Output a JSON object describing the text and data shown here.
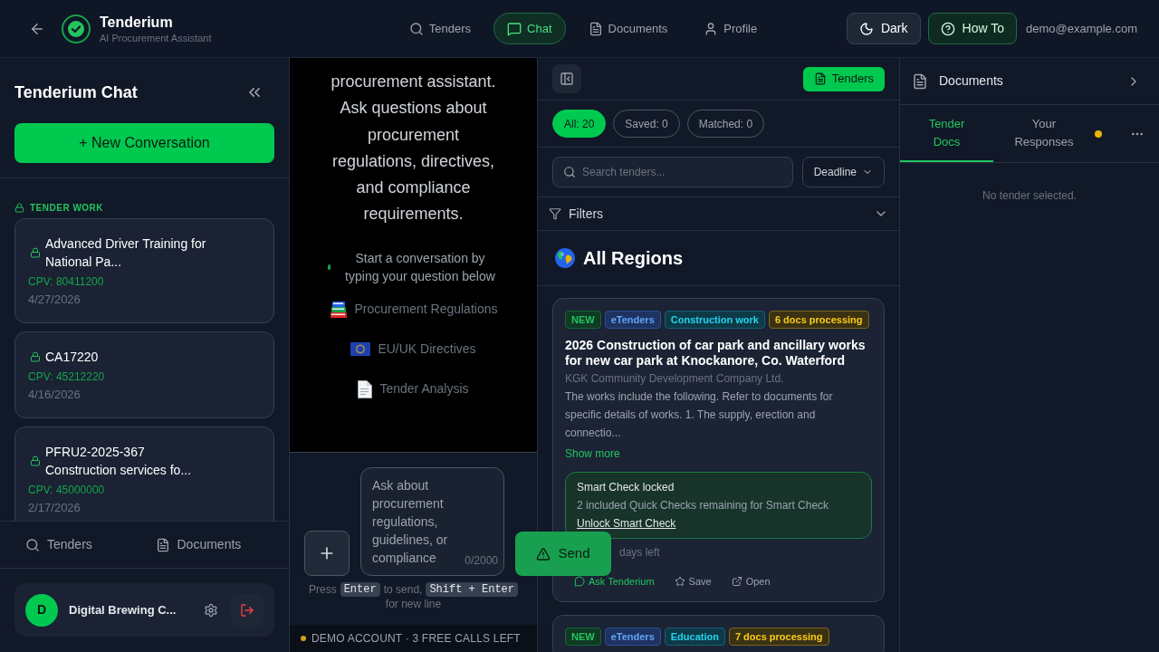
{
  "header": {
    "title": "Tenderium",
    "subtitle": "AI Procurement Assistant",
    "nav": [
      {
        "kind": "search",
        "label": "Tenders",
        "selected": false
      },
      {
        "kind": "chat",
        "label": "Chat",
        "selected": true
      },
      {
        "kind": "document",
        "label": "Documents",
        "selected": false
      },
      {
        "kind": "user",
        "label": "Profile",
        "selected": false
      }
    ],
    "theme_button": "Dark",
    "help_button": "How To",
    "user_email": "demo@example.com"
  },
  "sidebar": {
    "title": "Tenderium Chat",
    "new_button": "+ New Conversation",
    "section_label": "TENDER WORK",
    "conversations": [
      {
        "title": "Advanced Driver Training for National Pa...",
        "cpv": "CPV: 80411200",
        "date": "4/27/2026"
      },
      {
        "title": "CA17220",
        "cpv": "CPV: 45212220",
        "date": "4/16/2026"
      },
      {
        "title": "PFRU2-2025-367 Construction services fo...",
        "cpv": "CPV: 45000000",
        "date": "2/17/2026"
      }
    ],
    "bottom_nav": [
      {
        "kind": "search",
        "label": "Tenders"
      },
      {
        "kind": "document",
        "label": "Documents"
      }
    ],
    "user": {
      "initial": "D",
      "name": "Digital Brewing C..."
    }
  },
  "chat": {
    "intro": "procurement assistant. Ask questions about procurement regulations, directives, and compliance requirements.",
    "prompt": "Start a conversation by typing your question below",
    "topics": [
      {
        "kind": "books",
        "label": "Procurement Regulations"
      },
      {
        "kind": "flag",
        "label": "EU/UK Directives"
      },
      {
        "kind": "document",
        "label": "Tender Analysis"
      }
    ],
    "input": {
      "placeholder": "Ask about procurement regulations, guidelines, or compliance",
      "counter": "0/2000"
    },
    "send_button": "Send",
    "hint": [
      {
        "kind": "text",
        "text": "Press"
      },
      {
        "kind": "key",
        "text": "Enter"
      },
      {
        "kind": "text",
        "text": "to send,"
      },
      {
        "kind": "key",
        "text": "Shift + Enter"
      },
      {
        "kind": "text",
        "text": "for new line"
      }
    ],
    "status": "DEMO ACCOUNT · 3 FREE CALLS LEFT"
  },
  "tenders": {
    "panel_button": "Tenders",
    "filters": [
      {
        "label": "All: 20",
        "selected": true
      },
      {
        "label": "Saved: 0",
        "selected": false
      },
      {
        "label": "Matched: 0",
        "selected": false
      }
    ],
    "search": {
      "placeholder": "Search tenders..."
    },
    "sort": "Deadline",
    "filters_label": "Filters",
    "region": "All Regions",
    "cards": [
      {
        "badges": [
          {
            "kind": "new",
            "label": "NEW"
          },
          {
            "kind": "source",
            "label": "eTenders"
          },
          {
            "kind": "category",
            "label": "Construction work"
          },
          {
            "kind": "processing",
            "label": "6 docs processing"
          }
        ],
        "title": "2026 Construction of car park and ancillary works for new car park at Knockanore, Co. Waterford",
        "org": "KGK Community Development Company Ltd.",
        "description": "The works include the following. Refer to documents for specific details of works. 1. The supply, erection and connectio...",
        "show_more": "Show more",
        "smart_check": {
          "title": "Smart Check locked",
          "text": "2 included Quick Checks remaining for Smart Check",
          "link": "Unlock Smart Check"
        },
        "deadline": "days left",
        "actions": [
          {
            "kind": "ask",
            "label": "Ask Tenderium"
          },
          {
            "kind": "save",
            "label": "Save"
          },
          {
            "kind": "open",
            "label": "Open"
          }
        ]
      },
      {
        "badges": [
          {
            "kind": "new",
            "label": "NEW"
          },
          {
            "kind": "source",
            "label": "eTenders"
          },
          {
            "kind": "category",
            "label": "Education"
          },
          {
            "kind": "processing",
            "label": "7 docs processing"
          }
        ]
      }
    ]
  },
  "documents": {
    "title": "Documents",
    "tabs": [
      {
        "label": "Tender Docs",
        "selected": true,
        "dot": false
      },
      {
        "label": "Your Responses",
        "selected": false,
        "dot": true
      }
    ],
    "empty": "No tender selected."
  }
}
